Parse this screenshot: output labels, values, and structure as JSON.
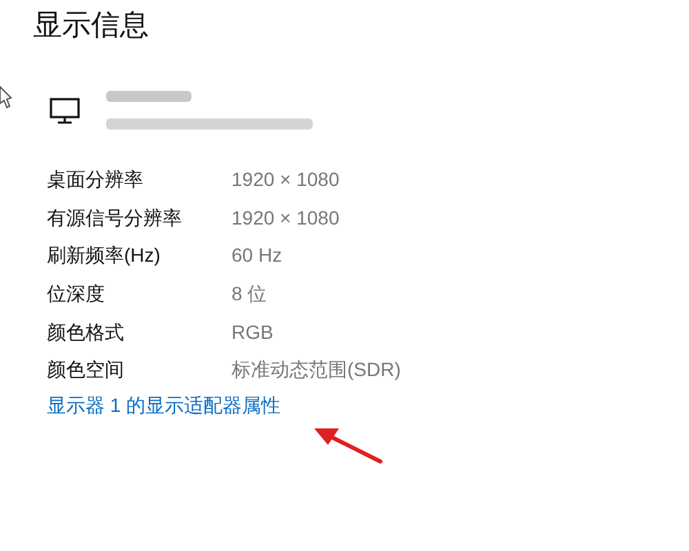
{
  "title": "显示信息",
  "properties": [
    {
      "label": "桌面分辨率",
      "value": "1920 × 1080"
    },
    {
      "label": "有源信号分辨率",
      "value": "1920 × 1080"
    },
    {
      "label": "刷新频率(Hz)",
      "value": "60 Hz"
    },
    {
      "label": "位深度",
      "value": "8 位"
    },
    {
      "label": "颜色格式",
      "value": "RGB"
    },
    {
      "label": "颜色空间",
      "value": "标准动态范围(SDR)"
    }
  ],
  "link": "显示器 1 的显示适配器属性"
}
